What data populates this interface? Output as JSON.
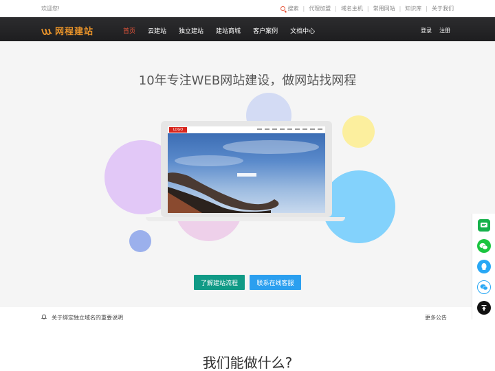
{
  "topbar": {
    "welcome": "欢迎您!",
    "links": [
      "搜索",
      "代理加盟",
      "域名主机",
      "常用网站",
      "知识库",
      "关于我们"
    ]
  },
  "nav": {
    "logo_text": "网程建站",
    "menu": [
      "首页",
      "云建站",
      "独立建站",
      "建站商城",
      "客户案例",
      "文档中心"
    ],
    "active_index": 0,
    "login": "登录",
    "register": "注册"
  },
  "hero": {
    "title": "10年专注WEB网站建设，做网站找网程",
    "laptop_logo": "LOGO",
    "btn_flow": "了解建站流程",
    "btn_service": "联系在线客服"
  },
  "notice": {
    "text": "关于绑定独立域名的重要说明",
    "more": "更多公告"
  },
  "section": {
    "title": "我们能做什么?"
  },
  "float_bar": [
    "chat-icon",
    "wechat-icon",
    "qq-icon",
    "wechat-alt-icon",
    "back-to-top-icon"
  ],
  "colors": {
    "accent": "#e8553a",
    "logo": "#e8932a",
    "teal": "#109a86",
    "blue": "#2b9fef"
  }
}
